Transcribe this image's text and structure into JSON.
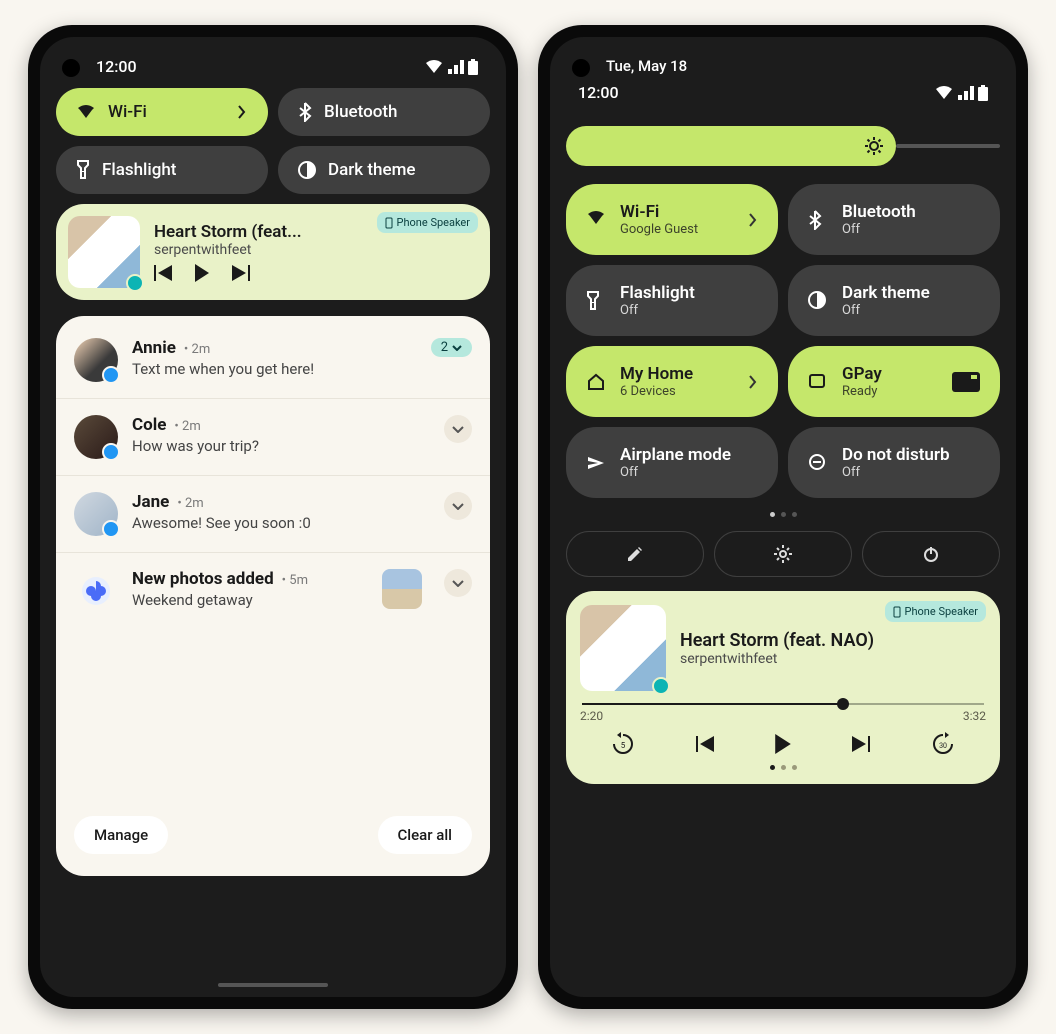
{
  "phone1": {
    "time": "12:00",
    "tiles": {
      "wifi": "Wi-Fi",
      "bluetooth": "Bluetooth",
      "flashlight": "Flashlight",
      "dark": "Dark theme"
    },
    "media": {
      "title": "Heart Storm (feat...",
      "artist": "serpentwithfeet",
      "output": "Phone Speaker"
    },
    "notifs": [
      {
        "name": "Annie",
        "time": "2m",
        "msg": "Text me when you get here!",
        "count": "2"
      },
      {
        "name": "Cole",
        "time": "2m",
        "msg": "How was your trip?"
      },
      {
        "name": "Jane",
        "time": "2m",
        "msg": "Awesome! See you soon :0"
      },
      {
        "name": "New photos added",
        "time": "5m",
        "msg": "Weekend getaway"
      }
    ],
    "actions": {
      "manage": "Manage",
      "clear": "Clear all"
    }
  },
  "phone2": {
    "date": "Tue, May 18",
    "time": "12:00",
    "tiles": [
      {
        "label": "Wi-Fi",
        "sub": "Google Guest",
        "active": true,
        "chev": true,
        "icon": "wifi"
      },
      {
        "label": "Bluetooth",
        "sub": "Off",
        "active": false,
        "icon": "bt"
      },
      {
        "label": "Flashlight",
        "sub": "Off",
        "active": false,
        "icon": "flash"
      },
      {
        "label": "Dark theme",
        "sub": "Off",
        "active": false,
        "icon": "dark"
      },
      {
        "label": "My Home",
        "sub": "6 Devices",
        "active": true,
        "chev": true,
        "icon": "home"
      },
      {
        "label": "GPay",
        "sub": "Ready",
        "active": true,
        "icon": "gpay",
        "card": true
      },
      {
        "label": "Airplane mode",
        "sub": "Off",
        "active": false,
        "icon": "plane"
      },
      {
        "label": "Do not disturb",
        "sub": "Off",
        "active": false,
        "icon": "dnd"
      }
    ],
    "media": {
      "title": "Heart Storm (feat. NAO)",
      "artist": "serpentwithfeet",
      "output": "Phone Speaker",
      "elapsed": "2:20",
      "total": "3:32"
    }
  }
}
